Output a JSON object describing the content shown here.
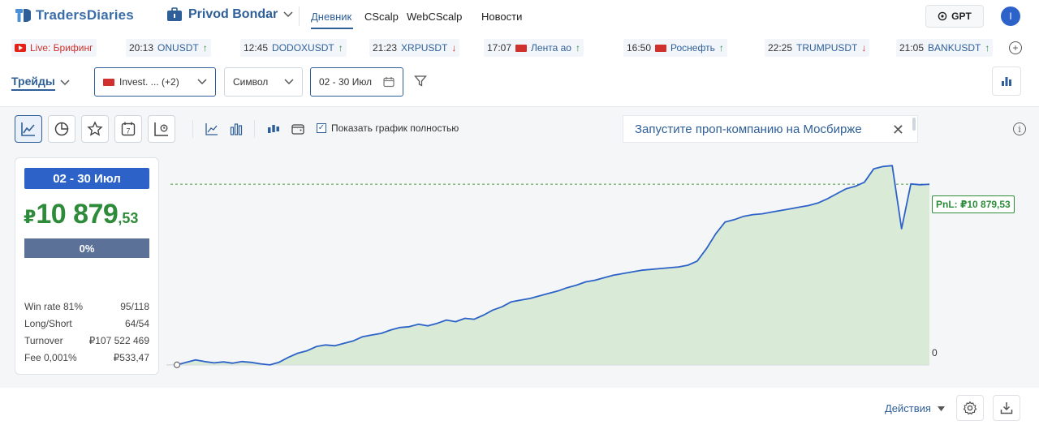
{
  "header": {
    "logo_text": "TradersDiaries",
    "workspace": "Privod Bondar",
    "nav": [
      "Дневник",
      "CScalp",
      "WebCScalp",
      "Новости"
    ],
    "gpt_label": "GPT",
    "avatar_letter": "I"
  },
  "ticker": [
    {
      "time": "",
      "symbol": "Live: Брифинг",
      "icon": "youtube-icon",
      "dir": ""
    },
    {
      "time": "20:13",
      "symbol": "ONUSDT",
      "icon": "",
      "dir": "up"
    },
    {
      "time": "12:45",
      "symbol": "DODOXUSDT",
      "icon": "",
      "dir": "up"
    },
    {
      "time": "21:23",
      "symbol": "XRPUSDT",
      "icon": "",
      "dir": "down"
    },
    {
      "time": "17:07",
      "symbol": "Лента ао",
      "icon": "flag-icon",
      "dir": "up"
    },
    {
      "time": "16:50",
      "symbol": "Роснефть",
      "icon": "flag-icon",
      "dir": "up"
    },
    {
      "time": "22:25",
      "symbol": "TRUMPUSDT",
      "icon": "",
      "dir": "down"
    },
    {
      "time": "21:05",
      "symbol": "BANKUSDT",
      "icon": "",
      "dir": "up"
    }
  ],
  "filters": {
    "trades_label": "Трейды",
    "account_label": "Invest. ... (+2)",
    "symbol_label": "Символ",
    "date_label": "02 - 30 Июл"
  },
  "toolbar": {
    "show_full_label": "Показать график полностью",
    "show_full_checked": true
  },
  "banner": {
    "text": "Запустите проп-компанию на Мосбирже"
  },
  "summary": {
    "date_range": "02 - 30 Июл",
    "currency": "₽",
    "pnl_int": "10 879",
    "pnl_dec": ",53",
    "percent": "0%",
    "stats": [
      {
        "label": "Win rate 81%",
        "value": "95/118"
      },
      {
        "label": "Long/Short",
        "value": "64/54"
      },
      {
        "label": "Turnover",
        "value": "₽107 522 469"
      },
      {
        "label": "Fee 0,001%",
        "value": "₽533,47"
      }
    ]
  },
  "chart_data": {
    "type": "area",
    "pnl_label": "PnL: ₽10 879,53",
    "zero_label": "0",
    "final_value": 10879.53,
    "series": [
      {
        "values": [
          0,
          150,
          300,
          200,
          120,
          180,
          100,
          200,
          150,
          60,
          0,
          160,
          450,
          700,
          850,
          1100,
          1200,
          1150,
          1300,
          1450,
          1700,
          1800,
          1900,
          2100,
          2250,
          2300,
          2450,
          2350,
          2500,
          2700,
          2600,
          2800,
          2750,
          3000,
          3300,
          3500,
          3800,
          3900,
          4000,
          4150,
          4300,
          4450,
          4650,
          4800,
          5000,
          5100,
          5250,
          5400,
          5500,
          5600,
          5700,
          5750,
          5800,
          5850,
          5900,
          6000,
          6250,
          7000,
          7900,
          8600,
          8750,
          8950,
          9050,
          9100,
          9200,
          9300,
          9400,
          9500,
          9600,
          9750,
          10000,
          10300,
          10600,
          10750,
          11000,
          11800,
          11950,
          12000,
          8200,
          10900,
          10850,
          10880
        ]
      }
    ],
    "ylim": [
      -300,
      12500
    ]
  },
  "footer": {
    "actions_label": "Действия"
  }
}
